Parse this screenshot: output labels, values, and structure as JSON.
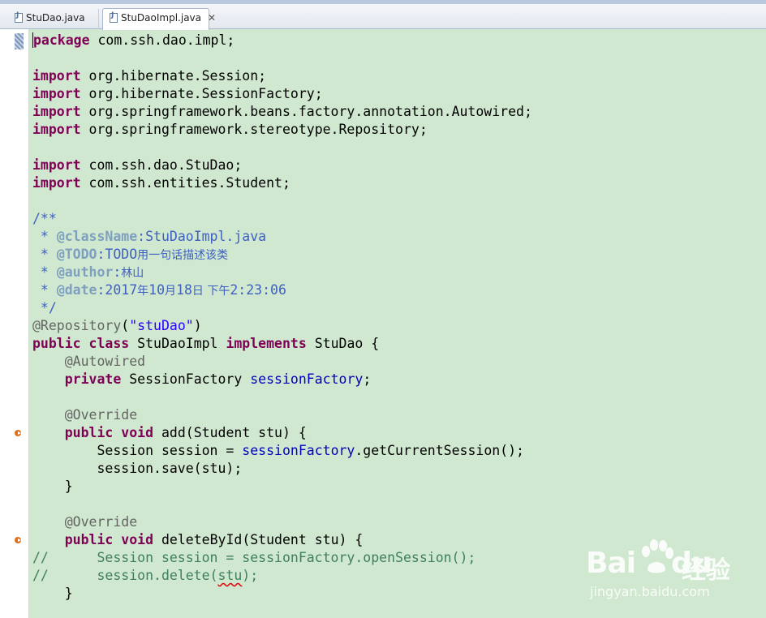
{
  "tabs": [
    {
      "label": "StuDao.java",
      "active": false
    },
    {
      "label": "StuDaoImpl.java",
      "active": true
    }
  ],
  "code": {
    "l1": {
      "kw": "package",
      "rest": " com.ssh.dao.impl;"
    },
    "l3": {
      "kw": "import",
      "rest": " org.hibernate.Session;"
    },
    "l4": {
      "kw": "import",
      "rest": " org.hibernate.SessionFactory;"
    },
    "l5": {
      "kw": "import",
      "rest": " org.springframework.beans.factory.annotation.Autowired;"
    },
    "l6": {
      "kw": "import",
      "rest": " org.springframework.stereotype.Repository;"
    },
    "l8": {
      "kw": "import",
      "rest": " com.ssh.dao.StuDao;"
    },
    "l9": {
      "kw": "import",
      "rest": " com.ssh.entities.Student;"
    },
    "l11": "/**",
    "l12": {
      "pre": " * ",
      "tag": "@className",
      "text": ":StuDaoImpl.java"
    },
    "l13": {
      "pre": " * ",
      "tag": "@TODO",
      "text": ":TODO",
      "cjk": "用一句话描述该类"
    },
    "l14": {
      "pre": " * ",
      "tag": "@author",
      "text": ":",
      "cjk": "林山"
    },
    "l15": {
      "pre": " * ",
      "tag": "@date",
      "text": ":2017",
      "cjk1": "年",
      "t2": "10",
      "cjk2": "月",
      "t3": "18",
      "cjk3": "日 下午",
      "t4": "2:23:06"
    },
    "l16": " */",
    "l17": {
      "ann": "@Repository",
      "p1": "(",
      "str": "\"stuDao\"",
      "p2": ")"
    },
    "l18": {
      "kw1": "public",
      "sp1": " ",
      "kw2": "class",
      "mid": " StuDaoImpl ",
      "kw3": "implements",
      "rest": " StuDao {"
    },
    "l19": {
      "ind": "    ",
      "ann": "@Autowired"
    },
    "l20": {
      "ind": "    ",
      "kw": "private",
      "type": " SessionFactory ",
      "fld": "sessionFactory",
      "end": ";"
    },
    "l22": {
      "ind": "    ",
      "ann": "@Override"
    },
    "l23": {
      "ind": "    ",
      "kw1": "public",
      "sp": " ",
      "kw2": "void",
      "rest": " add(Student stu) {"
    },
    "l24": {
      "ind": "        ",
      "a": "Session session = ",
      "fld": "sessionFactory",
      "b": ".getCurrentSession();"
    },
    "l25": "        session.save(stu);",
    "l26": "    }",
    "l28": {
      "ind": "    ",
      "ann": "@Override"
    },
    "l29": {
      "ind": "    ",
      "kw1": "public",
      "sp": " ",
      "kw2": "void",
      "rest": " deleteById(Student stu) {"
    },
    "l30": "//      Session session = sessionFactory.openSession();",
    "l31": {
      "a": "//      session.delete(",
      "sq": "stu",
      "b": ");"
    },
    "l32": "    }"
  },
  "watermark": {
    "logo": "Bai",
    "logo2": "du",
    "cn": "经验",
    "url": "jingyan.baidu.com"
  }
}
